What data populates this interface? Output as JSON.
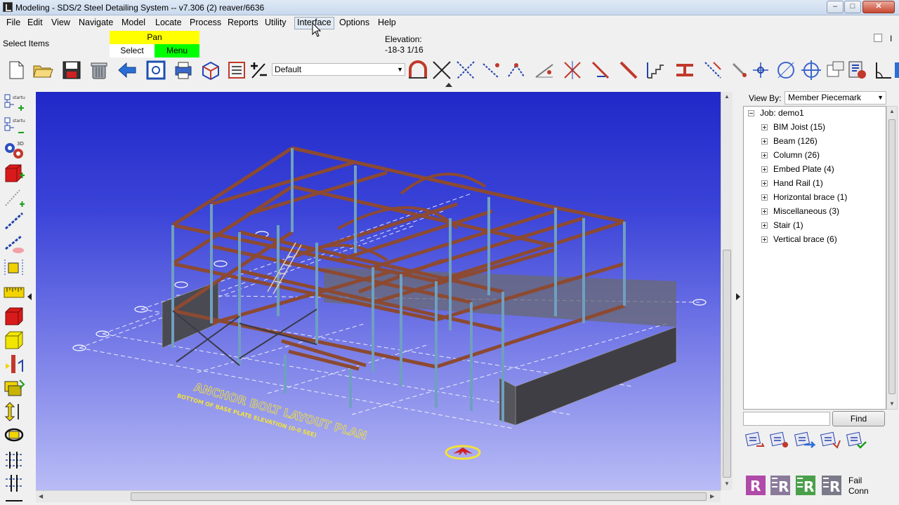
{
  "window": {
    "title": "Modeling - SDS/2 Steel Detailing System  --  v7.306  (2) reaver/6636",
    "minimize": "–",
    "maximize": "□",
    "close": "✕"
  },
  "menu": {
    "items": [
      "File",
      "Edit",
      "View",
      "Navigate",
      "Model",
      "Locate",
      "Process",
      "Reports",
      "Utility",
      "Interface",
      "Options",
      "Help"
    ],
    "hovered": "Interface"
  },
  "mode": {
    "status": "Select Items",
    "pan": "Pan",
    "select": "Select",
    "menu": "Menu",
    "colors": {
      "pan": "#ffff00",
      "menu": "#00ff00"
    }
  },
  "elevation": {
    "label": "Elevation:",
    "value": "-18-3 1/16"
  },
  "corner_label": "I",
  "toolbar": {
    "view_select_value": "Default",
    "icons": [
      "new-model-icon",
      "open-folder-icon",
      "save-icon",
      "trash-icon",
      "back-arrow-icon",
      "zoom-frame-icon",
      "print-icon",
      "3d-box-icon",
      "member-list-icon",
      "plus-minus-icon"
    ]
  },
  "model_view": {
    "anchor_title": "ANCHOR BOLT LAYOUT PLAN",
    "anchor_subtitle": "BOTTOM OF BASE PLATE ELEVATION (0-0 SEE)",
    "background_colors": {
      "top": "#2028c8",
      "bottom": "#b9bcf5"
    }
  },
  "right_panel": {
    "view_by_label": "View By:",
    "view_by_value": "Member Piecemark",
    "tree_root": "Job: demo1",
    "tree_items": [
      "BIM Joist (15)",
      "Beam (126)",
      "Column (26)",
      "Embed Plate (4)",
      "Hand Rail (1)",
      "Horizontal brace (1)",
      "Miscellaneous (3)",
      "Stair (1)",
      "Vertical brace (6)"
    ],
    "find_label": "Find",
    "fail_conn": [
      "Fail",
      "Conn"
    ]
  }
}
